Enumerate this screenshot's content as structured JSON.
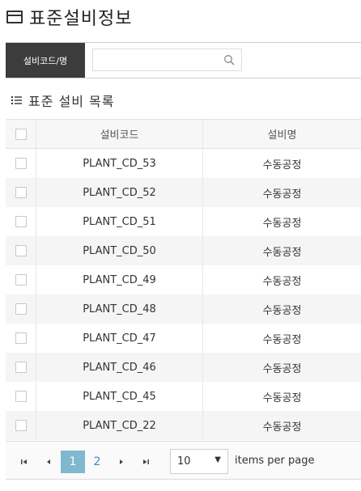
{
  "page": {
    "title": "표준설비정보"
  },
  "search": {
    "label": "설비코드/명",
    "value": "",
    "placeholder": ""
  },
  "section": {
    "title": "표준 설비 목록"
  },
  "table": {
    "columns": [
      "설비코드",
      "설비명"
    ],
    "rows": [
      {
        "code": "PLANT_CD_53",
        "name": "수동공정"
      },
      {
        "code": "PLANT_CD_52",
        "name": "수동공정"
      },
      {
        "code": "PLANT_CD_51",
        "name": "수동공정"
      },
      {
        "code": "PLANT_CD_50",
        "name": "수동공정"
      },
      {
        "code": "PLANT_CD_49",
        "name": "수동공정"
      },
      {
        "code": "PLANT_CD_48",
        "name": "수동공정"
      },
      {
        "code": "PLANT_CD_47",
        "name": "수동공정"
      },
      {
        "code": "PLANT_CD_46",
        "name": "수동공정"
      },
      {
        "code": "PLANT_CD_45",
        "name": "수동공정"
      },
      {
        "code": "PLANT_CD_22",
        "name": "수동공정"
      }
    ]
  },
  "pager": {
    "first": "⏮",
    "prev": "◀",
    "next": "▶",
    "last": "⏭",
    "pages": [
      "1",
      "2"
    ],
    "current_page": "1",
    "page_size": "10",
    "page_size_caret": "▼",
    "page_size_label": "items per page"
  },
  "colors": {
    "header_bar": "#3c3c3c",
    "active_page": "#7fb8cf",
    "page_link": "#3d8bbf"
  }
}
